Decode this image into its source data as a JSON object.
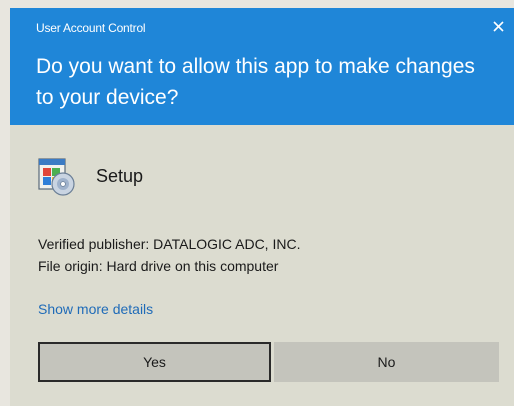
{
  "window": {
    "title": "User Account Control",
    "question": "Do you want to allow this app to make changes to your device?"
  },
  "app": {
    "name": "Setup",
    "icon": "setup-installer-icon"
  },
  "info": {
    "publisher": "Verified publisher: DATALOGIC ADC, INC.",
    "origin": "File origin: Hard drive on this computer"
  },
  "links": {
    "show_details": "Show more details"
  },
  "buttons": {
    "yes": "Yes",
    "no": "No"
  },
  "colors": {
    "header": "#1f86d8",
    "body": "#dcdcd0",
    "link": "#1f6bb8",
    "button": "#c4c4bc"
  }
}
